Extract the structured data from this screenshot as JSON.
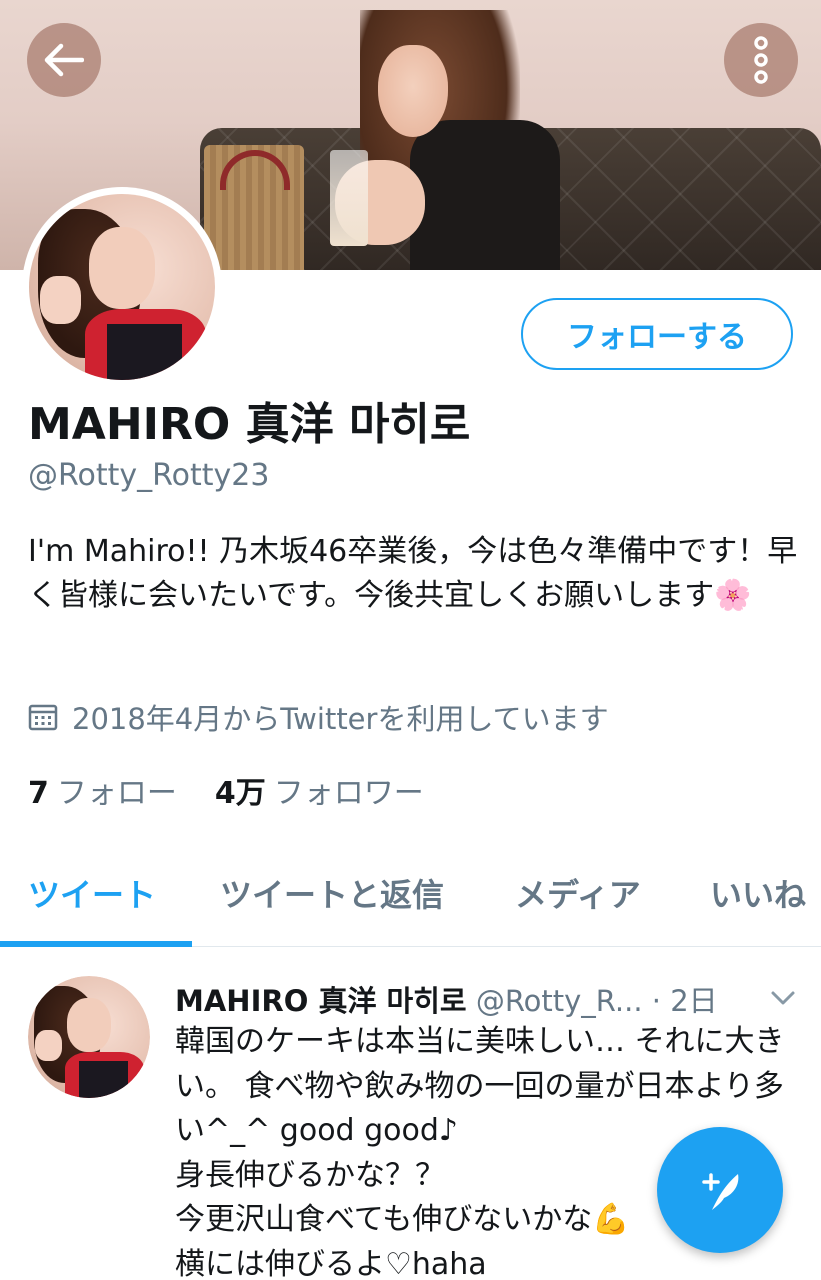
{
  "header": {
    "back_icon": "arrow-left-icon",
    "more_icon": "more-vertical-icon"
  },
  "profile": {
    "follow_label": "フォローする",
    "name": "MAHIRO 真洋 마히로",
    "handle": "@Rotty_Rotty23",
    "bio": "I'm Mahiro!! 乃木坂46卒業後，今は色々準備中です！早く皆様に会いたいです。今後共宜しくお願いします🌸",
    "joined": "2018年4月からTwitterを利用しています",
    "following_count": "7",
    "following_label": "フォロー",
    "followers_count": "4万",
    "followers_label": "フォロワー"
  },
  "tabs": [
    {
      "label": "ツイート",
      "active": true
    },
    {
      "label": "ツイートと返信",
      "active": false
    },
    {
      "label": "メディア",
      "active": false
    },
    {
      "label": "いいね",
      "active": false
    }
  ],
  "tweet": {
    "name": "MAHIRO 真洋 마히로",
    "handle": "@Rotty_R...",
    "separator": "·",
    "time": "2日",
    "body": "韓国のケーキは本当に美味しい… それに大きい。 食べ物や飲み物の一回の量が日本より多い^_^ good good♪\n身長伸びるかな？？\n今更沢山食べても伸びないかな💪\n横には伸びるよ♡haha"
  },
  "fab": {
    "icon": "compose-tweet-icon"
  },
  "colors": {
    "accent": "#1da1f2",
    "secondary_text": "#657786",
    "primary_text": "#14171a"
  }
}
